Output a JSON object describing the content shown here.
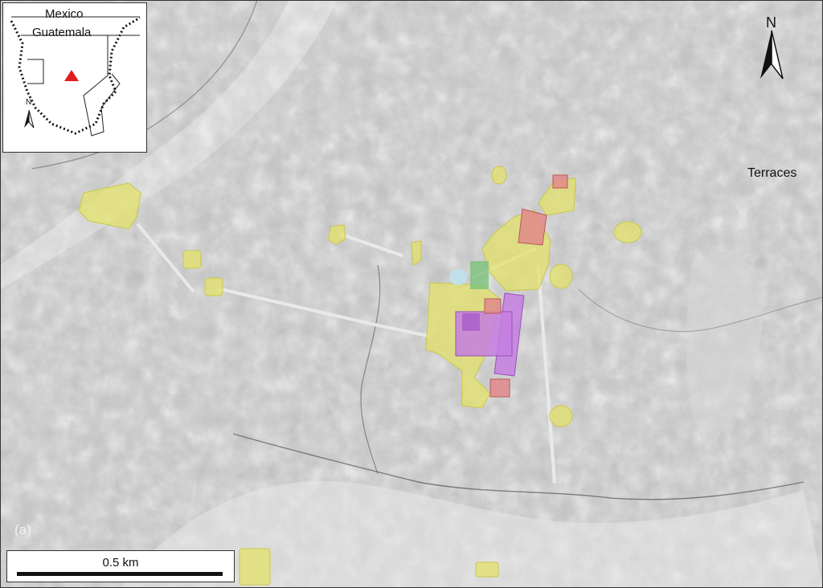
{
  "map": {
    "terraces_label": "Terraces",
    "panel_label": "(a)",
    "scale_label": "0.5 km",
    "north_letter": "N",
    "colors": {
      "hillshade_base": "#bdbdbd",
      "yellow_zone": "#e3e26a",
      "pink_structure": "#e08a8a",
      "purple_structure": "#c47ee0",
      "green_zone": "#7cc27c",
      "blue_zone": "#bfe3ee",
      "causeway": "#e6e6e6"
    }
  },
  "inset": {
    "country_north": "Mexico",
    "country_south": "Guatemala",
    "north_letter": "N",
    "site_marker_color": "#e01e1e",
    "site_marker": "triangle-icon"
  }
}
